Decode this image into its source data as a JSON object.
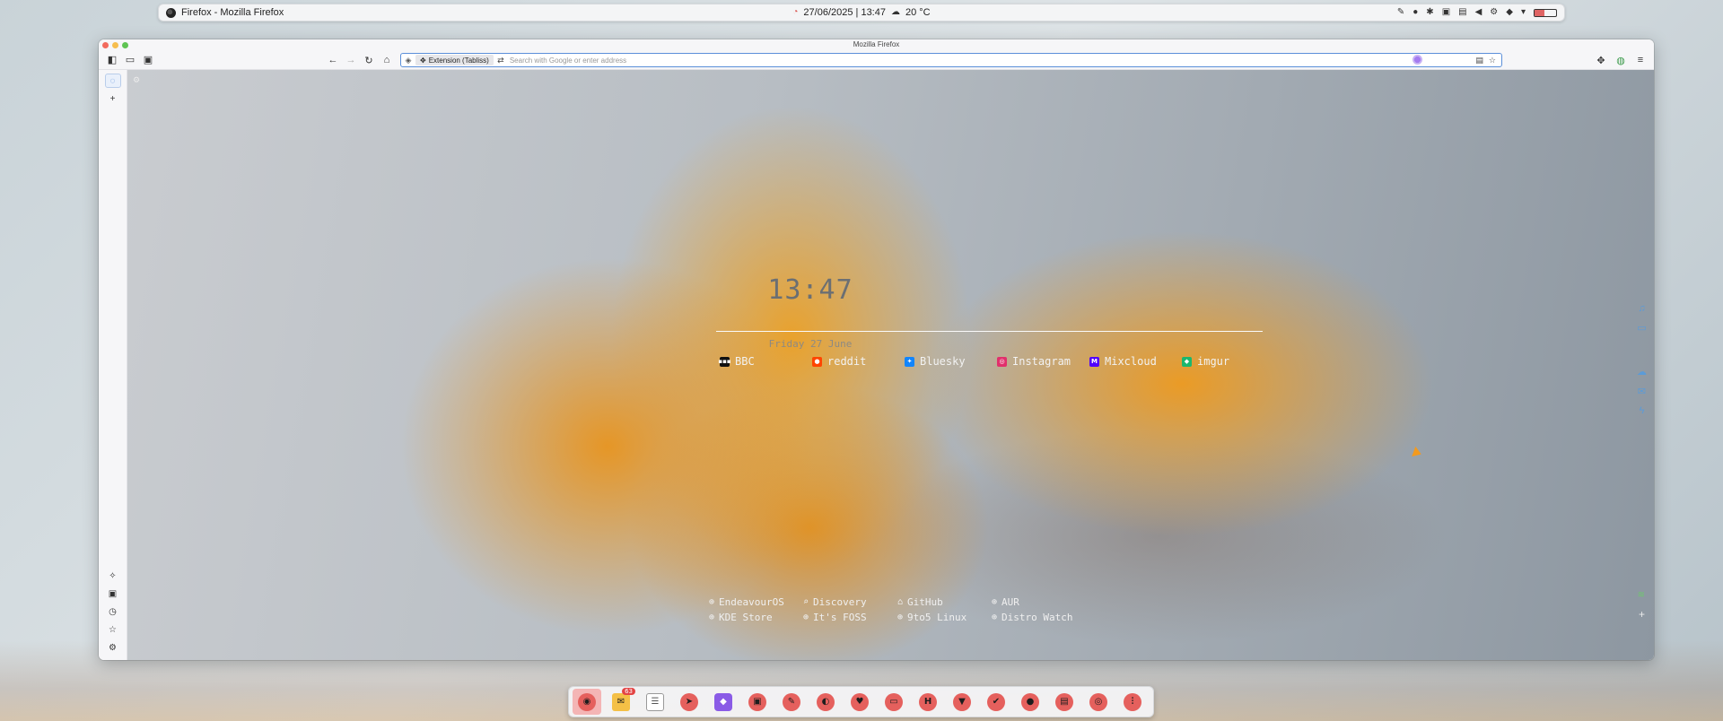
{
  "top_panel": {
    "app_title": "Firefox - Mozilla Firefox",
    "datetime": "27/06/2025 | 13:47",
    "weather_icon": "weather-icon",
    "temperature": "20 °C",
    "battery_level": 0.45,
    "colors": {
      "battery_fill": "#e06565"
    }
  },
  "window": {
    "title": "Mozilla Firefox",
    "toolbar": {
      "extension_chip": "Extension (Tabliss)",
      "url_placeholder": "Search with Google or enter address",
      "url_value": ""
    }
  },
  "tabliss": {
    "time": "13:47",
    "date": "Friday 27 June",
    "links": [
      {
        "label": "BBC",
        "icon": "bbc-icon",
        "color": "#111111",
        "glyph": "▪▪▪"
      },
      {
        "label": "reddit",
        "icon": "reddit-icon",
        "color": "#ff4500",
        "glyph": "●"
      },
      {
        "label": "Bluesky",
        "icon": "bluesky-icon",
        "color": "#1185fe",
        "glyph": "✦"
      },
      {
        "label": "Instagram",
        "icon": "instagram-icon",
        "color": "#e1306c",
        "glyph": "◎"
      },
      {
        "label": "Mixcloud",
        "icon": "mixcloud-icon",
        "color": "#5000ff",
        "glyph": "M"
      },
      {
        "label": "imgur",
        "icon": "imgur-icon",
        "color": "#1bb76e",
        "glyph": "◆"
      }
    ],
    "quick_links": [
      {
        "label": "EndeavourOS",
        "icon": "globe-icon",
        "glyph": "⊕"
      },
      {
        "label": "Discovery",
        "icon": "search-icon",
        "glyph": "⌕"
      },
      {
        "label": "GitHub",
        "icon": "github-icon",
        "glyph": "⌂"
      },
      {
        "label": "AUR",
        "icon": "globe-icon",
        "glyph": "⊕"
      },
      {
        "label": "KDE Store",
        "icon": "globe-icon",
        "glyph": "⊕"
      },
      {
        "label": "It's FOSS",
        "icon": "globe-icon",
        "glyph": "⊕"
      },
      {
        "label": "9to5 Linux",
        "icon": "globe-icon",
        "glyph": "⊕"
      },
      {
        "label": "Distro Watch",
        "icon": "globe-icon",
        "glyph": "⊕"
      }
    ]
  },
  "dock": {
    "mail_badge": "63",
    "items": [
      {
        "name": "firefox-icon",
        "glyph": "◉",
        "style": "",
        "active": true
      },
      {
        "name": "mail-icon",
        "glyph": "✉",
        "style": "mail",
        "active": false
      },
      {
        "name": "tasks-icon",
        "glyph": "☰",
        "style": "list",
        "active": false
      },
      {
        "name": "telegram-icon",
        "glyph": "➤",
        "style": "",
        "active": false
      },
      {
        "name": "obsidian-icon",
        "glyph": "◆",
        "style": "gem",
        "active": false
      },
      {
        "name": "files-icon",
        "glyph": "▣",
        "style": "",
        "active": false
      },
      {
        "name": "editor-icon",
        "glyph": "✎",
        "style": "",
        "active": false
      },
      {
        "name": "palette-icon",
        "glyph": "◐",
        "style": "",
        "active": false
      },
      {
        "name": "heart-icon",
        "glyph": "♥",
        "style": "",
        "active": false
      },
      {
        "name": "terminal-icon",
        "glyph": "▭",
        "style": "",
        "active": false
      },
      {
        "name": "hex-icon",
        "glyph": "H",
        "style": "",
        "active": false
      },
      {
        "name": "vpn-icon",
        "glyph": "▼",
        "style": "",
        "active": false
      },
      {
        "name": "check-icon",
        "glyph": "✔",
        "style": "",
        "active": false
      },
      {
        "name": "camera-icon",
        "glyph": "●",
        "style": "",
        "active": false
      },
      {
        "name": "archive-icon",
        "glyph": "▤",
        "style": "",
        "active": false
      },
      {
        "name": "disk-icon",
        "glyph": "◎",
        "style": "",
        "active": false
      },
      {
        "name": "mixer-icon",
        "glyph": "⫶",
        "style": "",
        "active": false
      }
    ]
  }
}
